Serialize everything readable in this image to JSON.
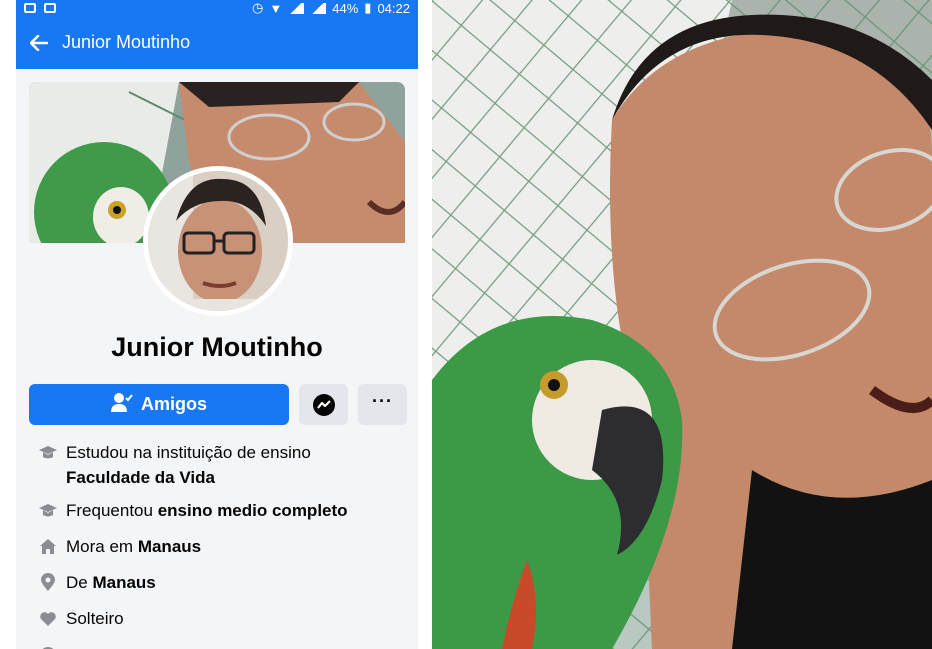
{
  "status_bar": {
    "battery": "44%",
    "time": "04:22"
  },
  "header": {
    "back_icon": "arrow-left-icon",
    "title": "Junior Moutinho"
  },
  "profile": {
    "name": "Junior Moutinho"
  },
  "actions": {
    "friends_label": "Amigos",
    "friends_icon": "user-check-icon",
    "messenger_icon": "messenger-icon",
    "more_icon": "more-icon"
  },
  "details": [
    {
      "icon": "graduation-cap-icon",
      "prefix": "Estudou na instituição de ensino",
      "bold": "Faculdade da Vida",
      "multiline": true
    },
    {
      "icon": "graduation-cap-icon",
      "prefix": "Frequentou",
      "bold": "ensino medio completo"
    },
    {
      "icon": "home-icon",
      "prefix": "Mora em",
      "bold": "Manaus"
    },
    {
      "icon": "location-pin-icon",
      "prefix": "De",
      "bold": "Manaus"
    },
    {
      "icon": "heart-icon",
      "prefix": "Solteiro",
      "bold": ""
    }
  ],
  "colors": {
    "facebook_blue": "#1877f2",
    "secondary_button": "#e4e6eb",
    "icon_gray": "#8a8d91"
  }
}
